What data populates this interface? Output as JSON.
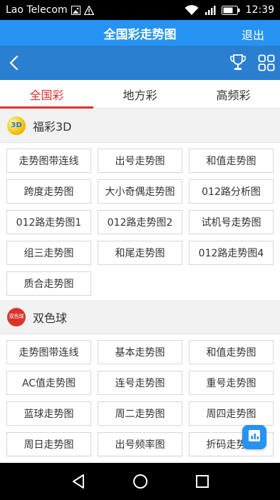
{
  "status": {
    "carrier": "Lao Telecom",
    "time": "12:39"
  },
  "header": {
    "title": "全国彩走势图",
    "exit_label": "退出"
  },
  "tabs": [
    {
      "label": "全国彩",
      "active": true
    },
    {
      "label": "地方彩",
      "active": false
    },
    {
      "label": "高频彩",
      "active": false
    }
  ],
  "sections": [
    {
      "name": "福彩3D",
      "icon": "fucai-3d-logo",
      "buttons": [
        "走势图带连线",
        "出号走势图",
        "和值走势图",
        "跨度走势图",
        "大小奇偶走势图",
        "012路分析图",
        "012路走势图1",
        "012路走势图2",
        "试机号走势图",
        "组三走势图",
        "和尾走势图",
        "012路走势图4",
        "质合走势图"
      ]
    },
    {
      "name": "双色球",
      "icon": "shuangseqiu-logo",
      "icon_text": "双色球",
      "buttons": [
        "走势图带连线",
        "基本走势图",
        "和值走势图",
        "AC值走势图",
        "连号走势图",
        "重号走势图",
        "蓝球走势图",
        "周二走势图",
        "周四走势图",
        "周日走势图",
        "出号频率图",
        "折码走势图"
      ]
    }
  ],
  "colors": {
    "title_bar": "#2693f3",
    "sub_bar": "#2a7fd0",
    "active_tab": "#e0322e"
  }
}
